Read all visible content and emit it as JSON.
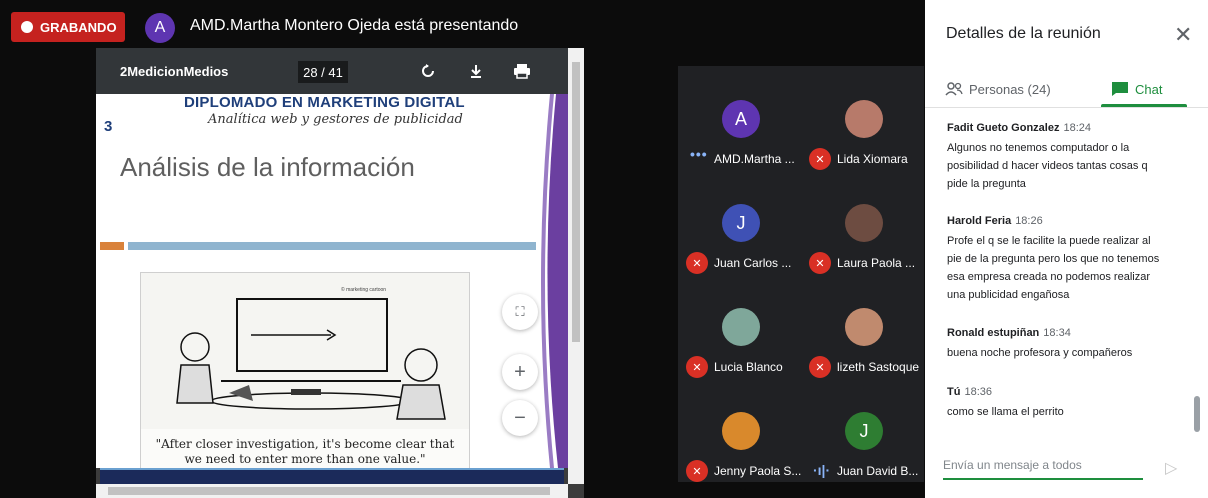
{
  "top_bar": {
    "recording_label": "GRABANDO",
    "presenter_initial": "A",
    "presenter_text": "AMD.Martha Montero Ojeda está presentando"
  },
  "pdf": {
    "title": "2MedicionMedios",
    "page_indicator": "28 / 41",
    "icons": [
      "rotate-icon",
      "download-icon",
      "print-icon"
    ],
    "slide": {
      "header": "DIPLOMADO EN MARKETING DIGITAL",
      "subheader": "Analítica web y gestores de publicidad",
      "number": "3",
      "title": "Análisis de la información",
      "caption_line1": "\"After closer investigation, it's become clear that",
      "caption_line2": "we need to enter more than one value.\""
    },
    "controls": {
      "fit": "⛶",
      "zoom_in": "+",
      "zoom_out": "−"
    }
  },
  "participants": [
    {
      "name": "AMD.Martha ...",
      "initial": "A",
      "color": "#5e35b1",
      "status": "more"
    },
    {
      "name": "Lida Xiomara",
      "initial": "",
      "color": "#b77a6a",
      "status": "muted"
    },
    {
      "name": "Juan Carlos ...",
      "initial": "J",
      "color": "#3f51b5",
      "status": "muted"
    },
    {
      "name": "Laura Paola ...",
      "initial": "",
      "color": "#6d4c41",
      "status": "muted"
    },
    {
      "name": "Lucia Blanco",
      "initial": "",
      "color": "#7fa79a",
      "status": "muted"
    },
    {
      "name": "lizeth Sastoque",
      "initial": "",
      "color": "#c08a6e",
      "status": "muted"
    },
    {
      "name": "Jenny Paola S...",
      "initial": "",
      "color": "#d9892c",
      "status": "muted"
    },
    {
      "name": "Juan David B...",
      "initial": "J",
      "color": "#2e7d32",
      "status": "speaking"
    }
  ],
  "panel": {
    "title": "Detalles de la reunión",
    "tab_people": "Personas (24)",
    "tab_chat": "Chat",
    "messages": [
      {
        "sender": "Fadit Gueto Gonzalez",
        "time": "18:24",
        "lines": [
          "Algunos no tenemos computador  o la",
          "posibilidad d hacer videos tantas cosas q",
          "pide la pregunta"
        ]
      },
      {
        "sender": "Harold Feria",
        "time": "18:26",
        "lines": [
          "Profe el q se le facilite la puede realizar al",
          "pie de la pregunta pero los que no tenemos",
          "esa empresa creada no podemos realizar",
          "una publicidad engañosa"
        ]
      },
      {
        "sender": "Ronald estupiñan",
        "time": "18:34",
        "lines": [
          "buena noche profesora y compañeros"
        ]
      },
      {
        "sender": "Tú",
        "time": "18:36",
        "lines": [
          "como se llama el perrito"
        ]
      }
    ],
    "input_placeholder": "Envía un mensaje a todos"
  },
  "colors": {
    "recording": "#c5221f",
    "chat_accent": "#1e8e3e",
    "muted": "#d93025"
  }
}
